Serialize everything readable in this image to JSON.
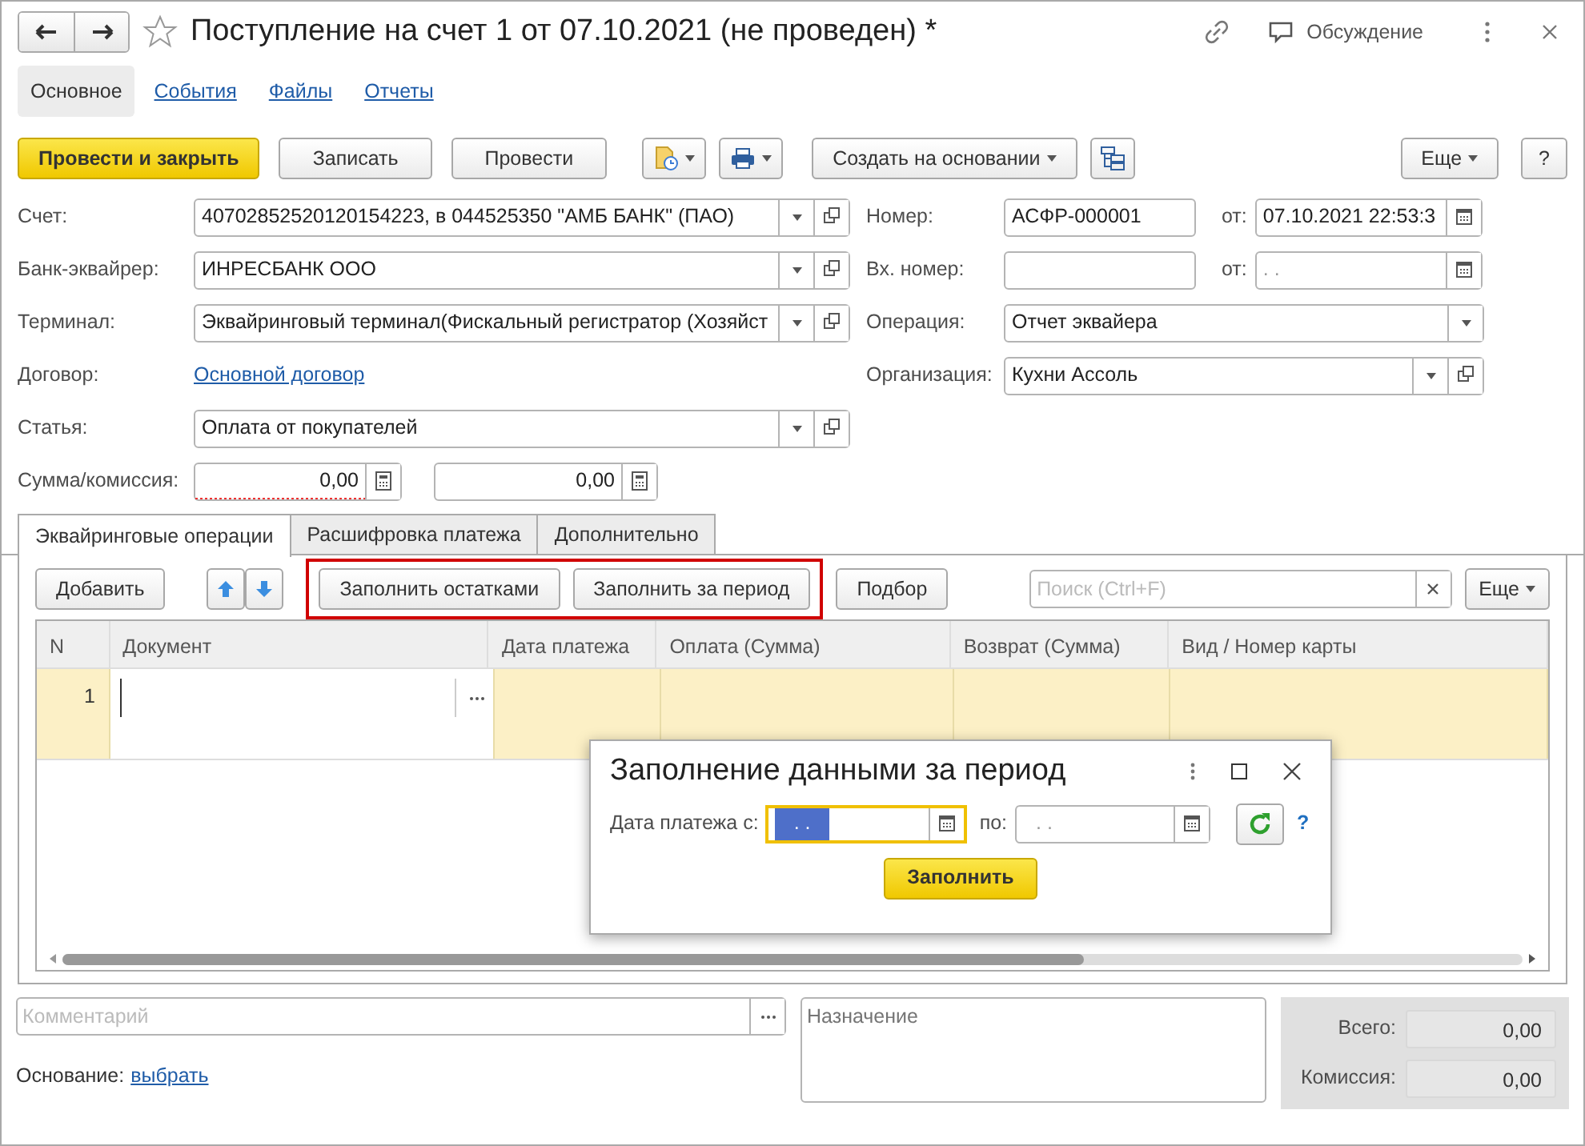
{
  "window": {
    "title": "Поступление на счет 1 от 07.10.2021 (не проведен) *",
    "discussion": "Обсуждение"
  },
  "nav_tabs": [
    {
      "label": "Основное",
      "selected": true
    },
    {
      "label": "События",
      "selected": false
    },
    {
      "label": "Файлы",
      "selected": false
    },
    {
      "label": "Отчеты",
      "selected": false
    }
  ],
  "toolbar": {
    "primary": "Провести и закрыть",
    "buttons": [
      "Записать",
      "Провести"
    ],
    "create_based": "Создать на основании",
    "more": "Еще",
    "help": "?"
  },
  "left_fields": [
    {
      "kind": "select",
      "label": "Счет:",
      "value": "40702852520120154223, в 044525350 \"АМБ БАНК\" (ПАО)"
    },
    {
      "kind": "select",
      "label": "Банк-эквайрер:",
      "value": "ИНРЕСБАНК ООО"
    },
    {
      "kind": "select",
      "label": "Терминал:",
      "value": "Эквайринговый терминал(Фискальный регистратор (Хозяйст"
    },
    {
      "kind": "link",
      "label": "Договор:",
      "value": "Основной договор"
    },
    {
      "kind": "select",
      "label": "Статья:",
      "value": "Оплата от покупателей"
    },
    {
      "kind": "amounts",
      "label": "Сумма/комиссия:",
      "amounts": [
        {
          "value": "0,00",
          "required": true
        },
        {
          "value": "0,00",
          "required": false
        }
      ]
    }
  ],
  "right_fields": [
    {
      "kind": "number",
      "label": "Номер:",
      "value": "АСФР-000001",
      "date_label": "от:",
      "date": "07.10.2021 22:53:3"
    },
    {
      "kind": "number",
      "label": "Вх. номер:",
      "date_label": "от:",
      "date": ".  ."
    },
    {
      "kind": "select",
      "label": "Операция:",
      "value": "Отчет эквайера",
      "open_button": false
    },
    {
      "kind": "select",
      "label": "Организация:",
      "value": "Кухни Ассоль",
      "open_button": true
    }
  ],
  "tabs": [
    {
      "label": "Эквайринговые операции",
      "selected": true
    },
    {
      "label": "Расшифровка платежа",
      "selected": false
    },
    {
      "label": "Дополнительно",
      "selected": false
    }
  ],
  "table_toolbar": {
    "add": "Добавить",
    "fill_buttons": {
      "highlighted": true,
      "items": [
        "Заполнить остатками",
        "Заполнить за период"
      ]
    },
    "pick": "Подбор",
    "search_placeholder": "Поиск (Ctrl+F)",
    "more": "Еще"
  },
  "table": {
    "columns": [
      "N",
      "Документ",
      "Дата платежа",
      "Оплата (Сумма)",
      "Возврат (Сумма)",
      "Вид / Номер карты"
    ],
    "rows": [
      {
        "n": "1",
        "selected": true
      }
    ]
  },
  "dialog": {
    "title": "Заполнение данными за период",
    "from_label": "Дата платежа с:",
    "from_value": ".  .",
    "to_label": "по:",
    "to_value": ".  .",
    "button": "Заполнить",
    "help": "?"
  },
  "footer": {
    "comment_placeholder": "Комментарий",
    "purpose_placeholder": "Назначение",
    "basis_label": "Основание:",
    "basis_link": "выбрать",
    "totals": [
      {
        "label": "Всего:",
        "value": "0,00"
      },
      {
        "label": "Комиссия:",
        "value": "0,00"
      }
    ]
  }
}
